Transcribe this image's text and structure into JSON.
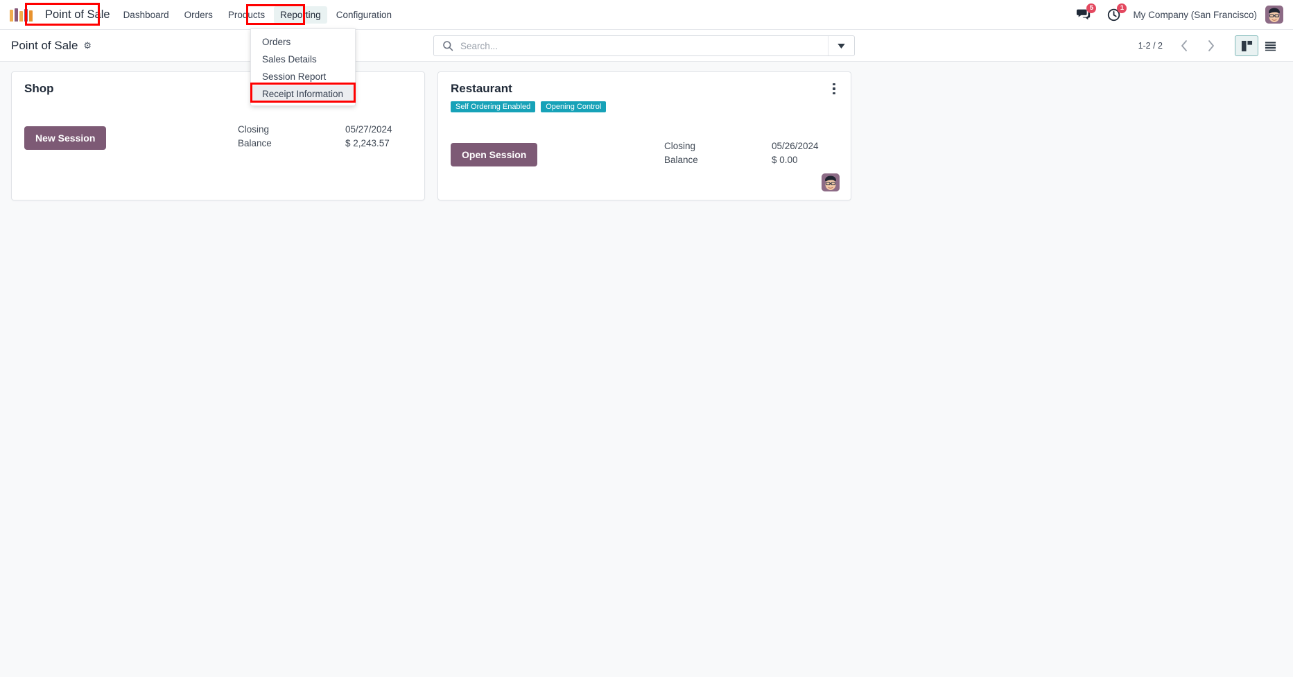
{
  "navbar": {
    "logo_icon": "odoo-logo-icon",
    "app_name": "Point of Sale",
    "menu_items": [
      {
        "label": "Dashboard",
        "active": false
      },
      {
        "label": "Orders",
        "active": false
      },
      {
        "label": "Products",
        "active": false
      },
      {
        "label": "Reporting",
        "active": true
      },
      {
        "label": "Configuration",
        "active": false
      }
    ],
    "messages_icon": "chat-bubbles-icon",
    "messages_count": "5",
    "activities_icon": "clock-icon",
    "activities_count": "1",
    "company": "My Company (San Francisco)",
    "avatar_icon": "user-avatar"
  },
  "dropdown": {
    "items": [
      {
        "label": "Orders",
        "focused": false
      },
      {
        "label": "Sales Details",
        "focused": false
      },
      {
        "label": "Session Report",
        "focused": false
      },
      {
        "label": "Receipt Information",
        "focused": true
      }
    ]
  },
  "control_panel": {
    "breadcrumb": "Point of Sale",
    "settings_icon": "gear-icon",
    "search_icon": "search-icon",
    "search_value": "",
    "search_placeholder": "Search...",
    "dropdown_toggle_icon": "chevron-down-icon",
    "pager": "1-2 / 2",
    "prev_icon": "chevron-left-icon",
    "next_icon": "chevron-right-icon",
    "kanban_view_icon": "kanban-view-icon",
    "list_view_icon": "list-view-icon"
  },
  "cards": [
    {
      "title": "Shop",
      "badges": [],
      "action_label": "New Session",
      "stats": [
        {
          "label": "Closing",
          "value": "05/27/2024"
        },
        {
          "label": "Balance",
          "value": "$ 2,243.57"
        }
      ],
      "has_kebab": false,
      "has_avatar": false
    },
    {
      "title": "Restaurant",
      "badges": [
        "Self Ordering Enabled",
        "Opening Control"
      ],
      "action_label": "Open Session",
      "stats": [
        {
          "label": "Closing",
          "value": "05/26/2024"
        },
        {
          "label": "Balance",
          "value": "$ 0.00"
        }
      ],
      "has_kebab": true,
      "has_avatar": true,
      "kebab_icon": "kebab-menu-icon",
      "avatar_icon": "user-avatar"
    }
  ],
  "annotations": {
    "accent_red": "#ff0000",
    "highlighted": [
      "app-name",
      "reporting-menu",
      "receipt-information-item"
    ]
  }
}
